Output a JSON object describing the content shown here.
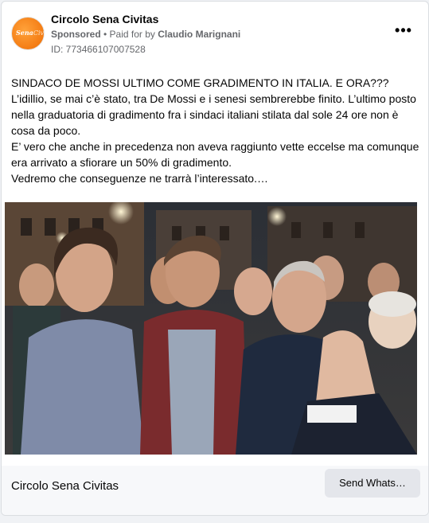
{
  "ad": {
    "page_name": "Circolo Sena Civitas",
    "sponsored_label": "Sponsored",
    "separator": " • ",
    "paid_for_prefix": "Paid for by ",
    "paid_for_name": "Claudio Marignani",
    "id_line": "ID: 773466107007528",
    "more_icon": "more-horizontal-icon",
    "avatar_logo_text_a": "Sena",
    "avatar_logo_text_b": "Civitas",
    "body_lines": [
      "SINDACO DE MOSSI ULTIMO COME GRADIMENTO IN ITALIA. E ORA???",
      "L’idillio, se mai c’è stato, tra De Mossi e i senesi sembrerebbe finito. L’ultimo posto nella graduatoria di gradimento fra i sindaci italiani stilata dal sole 24 ore non è cosa da poco.",
      "E’ vero che anche in precedenza non aveva raggiunto vette eccelse ma comunque era arrivato a sfiorare un 50% di gradimento.",
      "Vedremo che conseguenze ne trarrà l’interessato.…"
    ],
    "footer_name": "Circolo Sena Civitas",
    "cta_label": "Send Whats…"
  },
  "colors": {
    "brand_orange": "#f47c13",
    "secondary_text": "#65676b",
    "button_bg": "#e4e6eb",
    "footer_bg": "#f7f8fa"
  }
}
